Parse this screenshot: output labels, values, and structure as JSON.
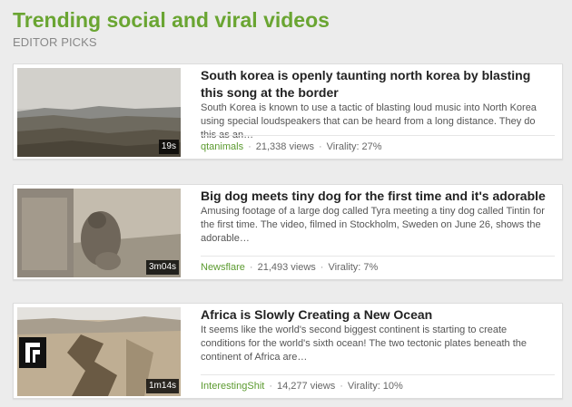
{
  "header": {
    "title": "Trending social and viral videos",
    "subtitle": "EDITOR PICKS"
  },
  "colors": {
    "accent": "#6aa532",
    "source_link": "#5b9a2f"
  },
  "videos": [
    {
      "title": "South korea is openly taunting north korea by blasting this song at the border",
      "description": "South Korea is known to use a tactic of blasting loud music into North Korea using special loudspeakers that can be heard from a long distance. They do this as an…",
      "duration": "19s",
      "source": "qtanimals",
      "views": "21,338 views",
      "virality": "Virality: 27%"
    },
    {
      "title": "Big dog meets tiny dog for the first time and it's adorable",
      "description": "Amusing footage of a large dog called Tyra meeting a tiny dog called Tintin for the first time. The video, filmed in Stockholm, Sweden on June 26, shows the adorable…",
      "duration": "3m04s",
      "source": "Newsflare",
      "views": "21,493 views",
      "virality": "Virality: 7%"
    },
    {
      "title": "Africa is Slowly Creating a New Ocean",
      "description": "It seems like the world's second biggest continent is starting to create conditions for the world's sixth ocean! The two tectonic plates beneath the continent of Africa are…",
      "duration": "1m14s",
      "source": "InterestingShit",
      "views": "14,277 views",
      "virality": "Virality: 10%"
    }
  ]
}
